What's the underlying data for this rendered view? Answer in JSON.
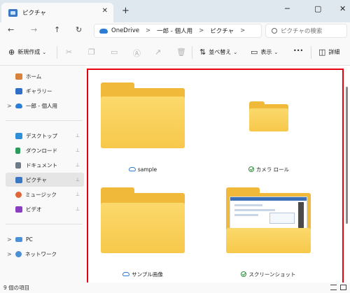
{
  "window": {
    "tab_title": "ピクチャ",
    "close_tab": "✕",
    "new_tab": "+",
    "minimize": "─",
    "maximize": "▢",
    "close": "✕"
  },
  "nav": {
    "back": "←",
    "forward": "→",
    "up": "↑",
    "refresh": "↻",
    "breadcrumb": [
      "OneDrive",
      "一郎 - 個人用",
      "ピクチャ"
    ],
    "separator": ">",
    "crumb_more": ">",
    "search_placeholder": "ピクチャの検索"
  },
  "toolbar": {
    "new_label": "新規作成",
    "sort_label": "並べ替え",
    "view_label": "表示",
    "more_label": "•••",
    "details_label": "詳細"
  },
  "sidebar": {
    "items": [
      {
        "label": "ホーム",
        "color": "#d9823b"
      },
      {
        "label": "ギャラリー",
        "color": "#2f6fc8"
      },
      {
        "label": "一郎 - 個人用",
        "color": "#2b7cd3"
      },
      {
        "label": "デスクトップ",
        "color": "#2f8fd8"
      },
      {
        "label": "ダウンロード",
        "color": "#2e9b5e"
      },
      {
        "label": "ドキュメント",
        "color": "#6f7a88"
      },
      {
        "label": "ピクチャ",
        "color": "#3b78c4"
      },
      {
        "label": "ミュージック",
        "color": "#e0663a"
      },
      {
        "label": "ビデオ",
        "color": "#8a3fc0"
      },
      {
        "label": "PC",
        "color": "#4b8fd6"
      },
      {
        "label": "ネットワーク",
        "color": "#4b8fd6"
      }
    ],
    "chevron": ">",
    "pin": "📌"
  },
  "folders": [
    {
      "name": "sample",
      "status": "cloud"
    },
    {
      "name": "カメラ ロール",
      "status": "synced"
    },
    {
      "name": "サンプル画像",
      "status": "cloud"
    },
    {
      "name": "スクリーンショット",
      "status": "synced"
    }
  ],
  "status": {
    "item_count": "9 個の項目"
  },
  "colors": {
    "selection_border": "#e60012",
    "folder": "#f7c84b",
    "accent": "#2b7cd3"
  }
}
